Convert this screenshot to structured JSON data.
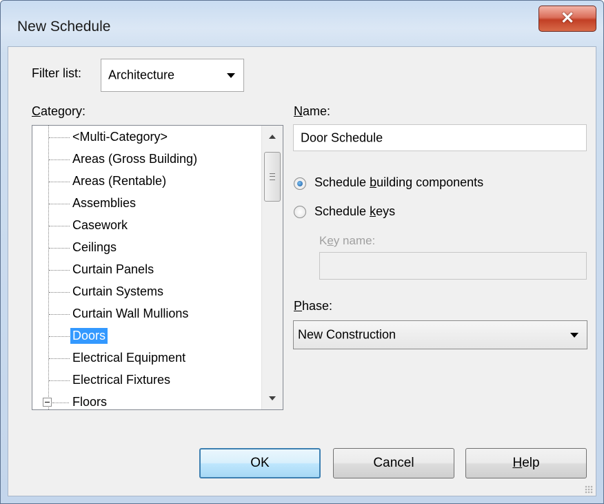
{
  "window": {
    "title": "New Schedule"
  },
  "filter": {
    "label": "Filter list:",
    "value": "Architecture"
  },
  "category": {
    "label": "Category:",
    "items": [
      "<Multi-Category>",
      "Areas (Gross Building)",
      "Areas (Rentable)",
      "Assemblies",
      "Casework",
      "Ceilings",
      "Curtain Panels",
      "Curtain Systems",
      "Curtain Wall Mullions",
      "Doors",
      "Electrical Equipment",
      "Electrical Fixtures",
      "Floors"
    ],
    "selected": "Doors"
  },
  "name": {
    "label": "Name:",
    "value": "Door Schedule"
  },
  "schedule_type": {
    "option_components": "Schedule building components",
    "option_keys": "Schedule keys",
    "selected": "Schedule building components"
  },
  "key_name": {
    "label": "Key name:",
    "value": ""
  },
  "phase": {
    "label": "Phase:",
    "value": "New Construction"
  },
  "buttons": {
    "ok": "OK",
    "cancel": "Cancel",
    "help": "Help"
  },
  "icons": {
    "close": "close-icon",
    "dropdown": "chevron-down-icon",
    "expander": "collapse-icon"
  }
}
